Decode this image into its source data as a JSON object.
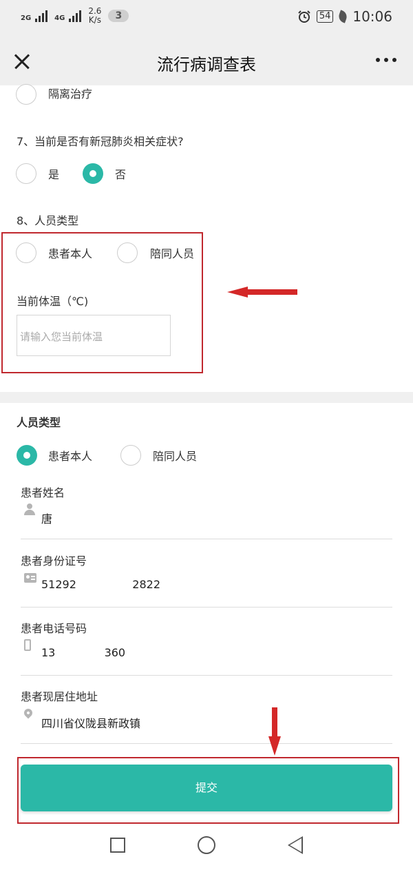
{
  "status_bar": {
    "sim1_label": "2G",
    "sim2_label": "4G",
    "speed_value": "2.6",
    "speed_unit": "K/s",
    "notification_count": "3",
    "battery": "54",
    "time": "10:06"
  },
  "header": {
    "title": "流行病调查表"
  },
  "form": {
    "prev_option": "隔离治疗",
    "q7": {
      "text": "7、当前是否有新冠肺炎相关症状?",
      "options": [
        "是",
        "否"
      ],
      "selected": "否"
    },
    "q8": {
      "text": "8、人员类型",
      "options": [
        "患者本人",
        "陪同人员"
      ]
    },
    "temperature": {
      "label": "当前体温（℃)",
      "placeholder": "请输入您当前体温"
    }
  },
  "person_section": {
    "title": "人员类型",
    "options": [
      "患者本人",
      "陪同人员"
    ],
    "selected": "患者本人",
    "fields": [
      {
        "label": "患者姓名",
        "value": "唐",
        "icon": "person-icon"
      },
      {
        "label": "患者身份证号",
        "value": "51292                2822",
        "icon": "id-card-icon"
      },
      {
        "label": "患者电话号码",
        "value": "13              360",
        "icon": "phone-icon"
      },
      {
        "label": "患者现居住地址",
        "value": "四川省仪陇县新政镇",
        "icon": "location-pin-icon"
      }
    ]
  },
  "submit": {
    "label": "提交"
  },
  "colors": {
    "accent": "#2bb8a7",
    "highlight": "#c0282e"
  }
}
